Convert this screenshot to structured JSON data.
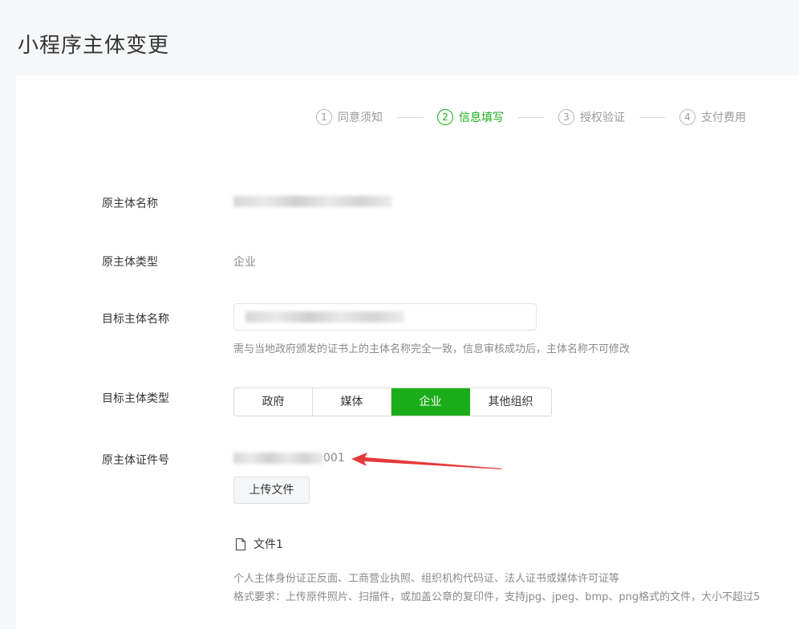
{
  "page": {
    "title": "小程序主体变更"
  },
  "steps": [
    {
      "num": "1",
      "label": "同意须知",
      "active": false
    },
    {
      "num": "2",
      "label": "信息填写",
      "active": true
    },
    {
      "num": "3",
      "label": "授权验证",
      "active": false
    },
    {
      "num": "4",
      "label": "支付费用",
      "active": false
    }
  ],
  "form": {
    "original_name": {
      "label": "原主体名称"
    },
    "original_type": {
      "label": "原主体类型",
      "value": "企业"
    },
    "target_name": {
      "label": "目标主体名称",
      "hint": "需与当地政府颁发的证书上的主体名称完全一致，信息审核成功后，主体名称不可修改"
    },
    "target_type": {
      "label": "目标主体类型",
      "options": [
        "政府",
        "媒体",
        "企业",
        "其他组织"
      ],
      "selected": "企业"
    },
    "cert_no": {
      "label": "原主体证件号",
      "value_suffix": "001",
      "upload_label": "上传文件",
      "file_label": "文件1",
      "desc_line1": "个人主体身份证正反面、工商营业执照、组织机构代码证、法人证书或媒体许可证等",
      "desc_line2": "格式要求：上传原件照片、扫描件，或加盖公章的复印件，支持jpg、jpeg、bmp、png格式的文件，大小不超过5"
    }
  },
  "colors": {
    "accent": "#1aad19",
    "arrow": "#e53a3a"
  }
}
